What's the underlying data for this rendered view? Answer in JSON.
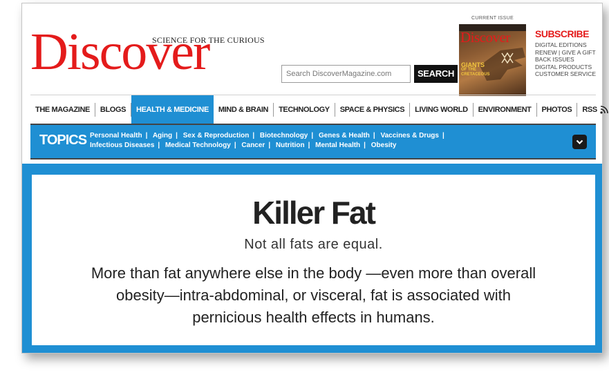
{
  "header": {
    "logo": "Discover",
    "tagline": "SCIENCE FOR THE CURIOUS",
    "search": {
      "placeholder": "Search DiscoverMagazine.com",
      "button": "SEARCH"
    },
    "current_issue": {
      "label": "CURRENT ISSUE",
      "cover_logo": "Discover",
      "cover_text_line1": "GIANTS",
      "cover_text_line2": "OF THE",
      "cover_text_line3": "CRETACEOUS"
    },
    "subscribe": {
      "title": "SUBSCRIBE",
      "links": [
        "DIGITAL EDITIONS",
        "RENEW | GIVE A GIFT",
        "BACK ISSUES",
        "DIGITAL PRODUCTS",
        "CUSTOMER SERVICE"
      ]
    }
  },
  "nav": {
    "items": [
      "THE MAGAZINE",
      "BLOGS",
      "HEALTH & MEDICINE",
      "MIND & BRAIN",
      "TECHNOLOGY",
      "SPACE & PHYSICS",
      "LIVING WORLD",
      "ENVIRONMENT",
      "PHOTOS",
      "RSS"
    ],
    "active": "HEALTH & MEDICINE",
    "active_color": "#1f8fd3"
  },
  "topics": {
    "label": "TOPICS",
    "row1": [
      "Personal Health",
      "Aging",
      "Sex & Reproduction",
      "Biotechnology",
      "Genes & Health",
      "Vaccines & Drugs"
    ],
    "row2": [
      "Infectious Diseases",
      "Medical Technology",
      "Cancer",
      "Nutrition",
      "Mental Health",
      "Obesity"
    ]
  },
  "article": {
    "title": "Killer Fat",
    "subtitle": "Not all fats are equal.",
    "body": "More than fat anywhere else in the body —even more than overall obesity—intra-abdominal, or visceral, fat is associated with pernicious health effects in humans."
  },
  "colors": {
    "brand_red": "#e41b1b",
    "accent_blue": "#1f8fd3"
  }
}
